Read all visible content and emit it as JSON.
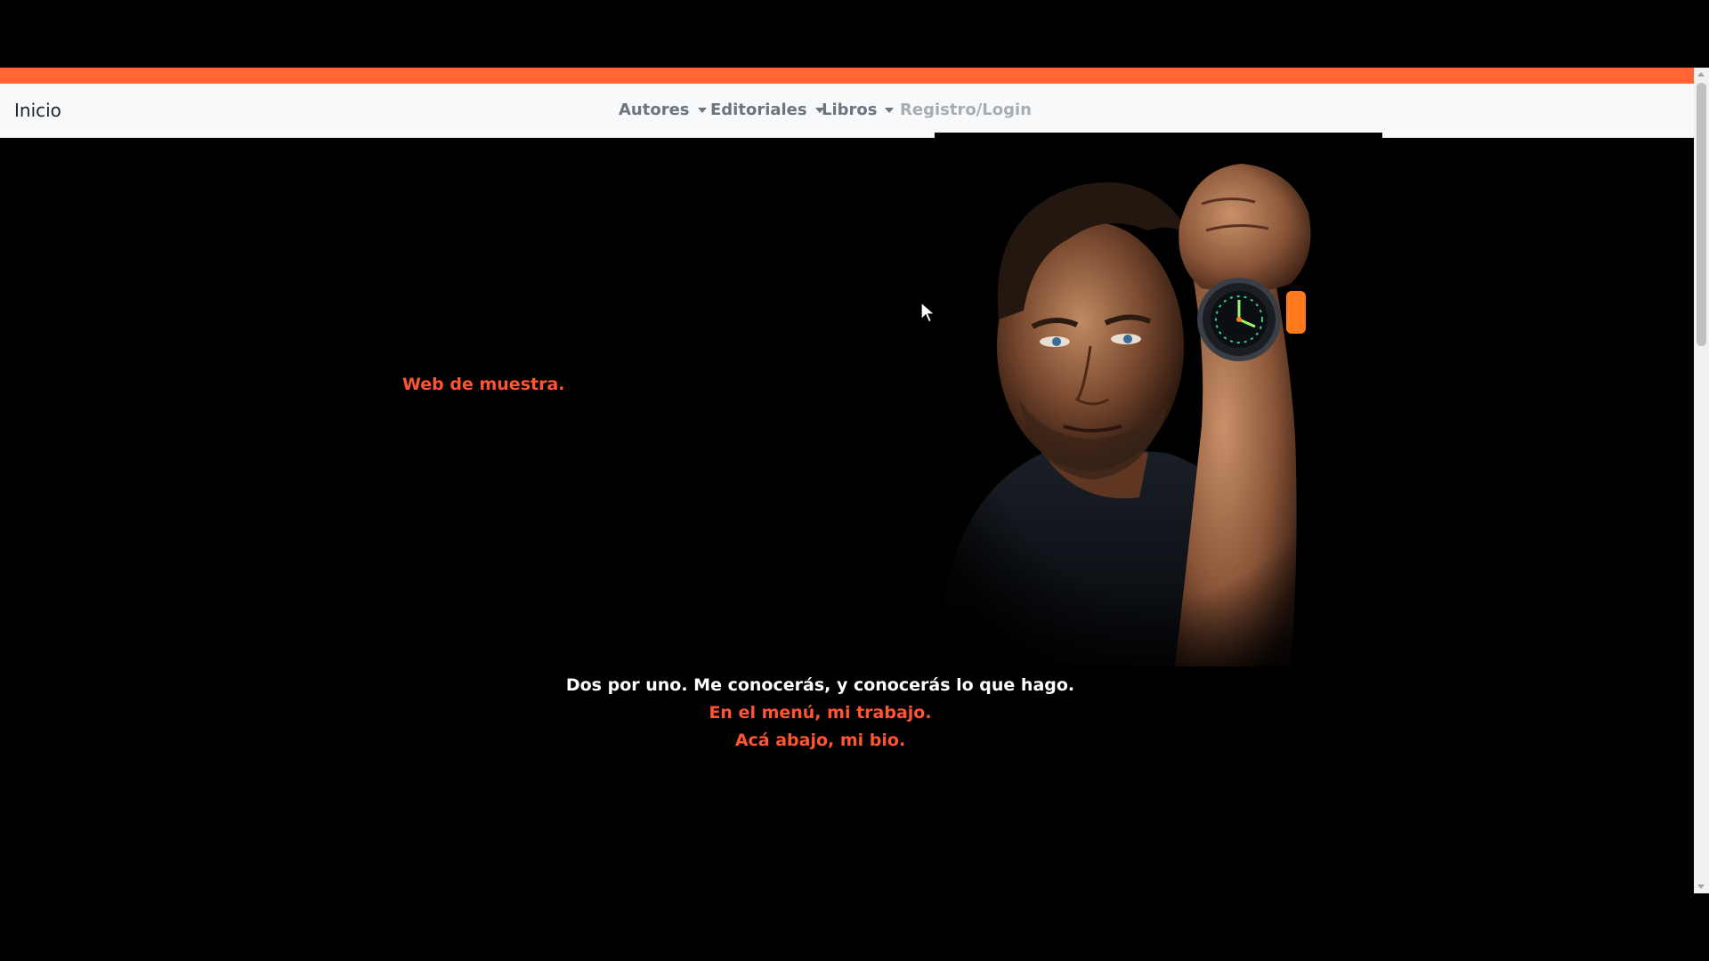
{
  "navbar": {
    "brand": "Inicio",
    "items": [
      {
        "label": "Autores",
        "dropdown": true
      },
      {
        "label": "Editoriales",
        "dropdown": true
      },
      {
        "label": "Libros",
        "dropdown": true
      },
      {
        "label": "Registro/Login",
        "dropdown": false,
        "disabled": true
      }
    ]
  },
  "hero": {
    "tagline": "Web de muestra.",
    "photo_icon": "portrait-photo"
  },
  "bio": {
    "line1": "Dos por uno. Me conocerás, y conocerás lo que hago.",
    "line2": "En el menú, mi trabajo.",
    "line3": "Acá abajo, mi bio."
  },
  "colors": {
    "accent": "#ff6633",
    "accent_text": "#ff5533",
    "navbar_bg": "#f8f9fa",
    "page_bg": "#000000"
  }
}
